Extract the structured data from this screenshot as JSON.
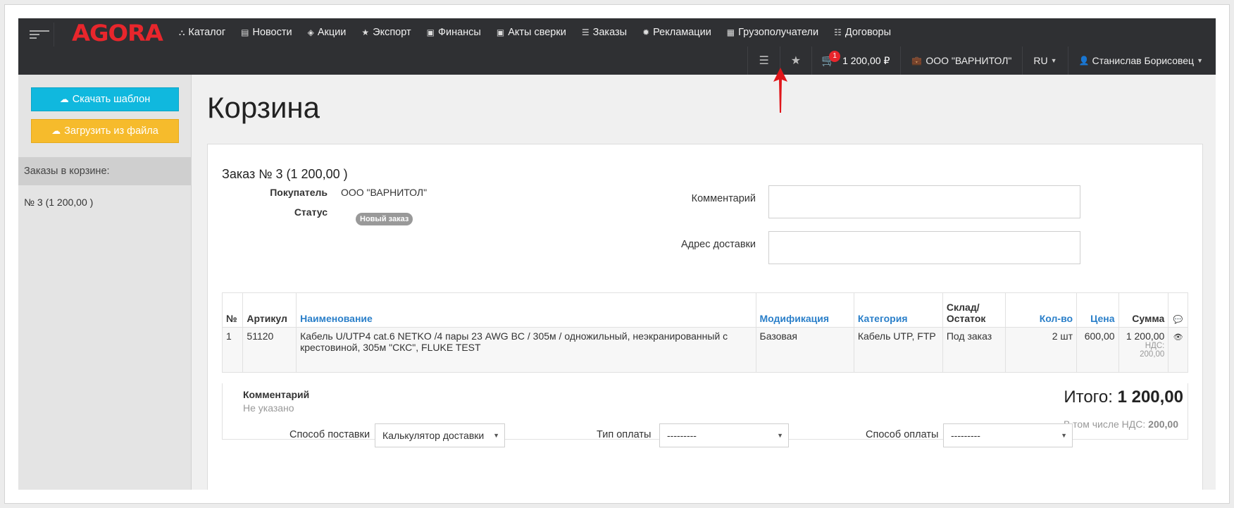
{
  "brand": {
    "logo_text": "AGORA",
    "logo_color": "#e8262c"
  },
  "nav": {
    "items": [
      {
        "label": "Каталог",
        "icon": "sitemap-icon",
        "glyph": "⛬"
      },
      {
        "label": "Новости",
        "icon": "document-icon",
        "glyph": "▤"
      },
      {
        "label": "Акции",
        "icon": "tags-icon",
        "glyph": "◈"
      },
      {
        "label": "Экспорт",
        "icon": "star-icon",
        "glyph": "★"
      },
      {
        "label": "Финансы",
        "icon": "money-icon",
        "glyph": "▣"
      },
      {
        "label": "Акты сверки",
        "icon": "money-icon",
        "glyph": "▣"
      },
      {
        "label": "Заказы",
        "icon": "list-icon",
        "glyph": "☰"
      },
      {
        "label": "Рекламации",
        "icon": "gear-icon",
        "glyph": "✹"
      },
      {
        "label": "Грузополучатели",
        "icon": "archive-icon",
        "glyph": "▦"
      },
      {
        "label": "Договоры",
        "icon": "list-alt-icon",
        "glyph": "☷"
      }
    ]
  },
  "subbar": {
    "list_glyph": "☰",
    "star_glyph": "★",
    "cart_count": "1",
    "cart_total": "1 200,00 ₽",
    "company": "ООО \"ВАРНИТОЛ\"",
    "language": "RU",
    "user": "Станислав Борисовец"
  },
  "sidebar": {
    "download_template": "Скачать шаблон",
    "upload_file": "Загрузить из файла",
    "orders_heading": "Заказы в корзине:",
    "order_link": "№ 3 (1 200,00 )"
  },
  "page": {
    "title": "Корзина"
  },
  "order": {
    "title": "Заказ № 3 (1 200,00 )",
    "buyer_label": "Покупатель",
    "buyer_value": "ООО \"ВАРНИТОЛ\"",
    "status_label": "Статус",
    "status_value": "Новый заказ",
    "comment_label": "Комментарий",
    "address_label": "Адрес доставки"
  },
  "table": {
    "headers": {
      "num": "№",
      "article": "Артикул",
      "name": "Наименование",
      "modification": "Модификация",
      "category": "Категория",
      "stock": "Склад/ Остаток",
      "qty": "Кол-во",
      "price": "Цена",
      "sum": "Сумма",
      "comment_glyph": "💬"
    },
    "rows": [
      {
        "num": "1",
        "article": "51120",
        "name": "Кабель U/UTP4 cat.6 NETKO /4 пары 23 AWG BC / 305м / одножильный, неэкранированный с крестовиной, 305м \"СКС\", FLUKE TEST",
        "modification": "Базовая",
        "category": "Кабель UTP, FTP",
        "stock": "Под заказ",
        "qty": "2 шт",
        "price": "600,00",
        "sum": "1 200,00",
        "vat": "НДС: 200,00",
        "action_glyph": "👁"
      }
    ]
  },
  "summary": {
    "comment_label": "Комментарий",
    "comment_value": "Не указано",
    "total_label": "Итого:",
    "total_value": "1 200,00",
    "vat_label": "В том числе НДС:",
    "vat_value": "200,00"
  },
  "delivery": {
    "method_label": "Способ поставки",
    "method_value": "Калькулятор доставки",
    "pay_type_label": "Тип оплаты",
    "pay_type_value": "---------",
    "pay_method_label": "Способ оплаты",
    "pay_method_value": "---------"
  }
}
